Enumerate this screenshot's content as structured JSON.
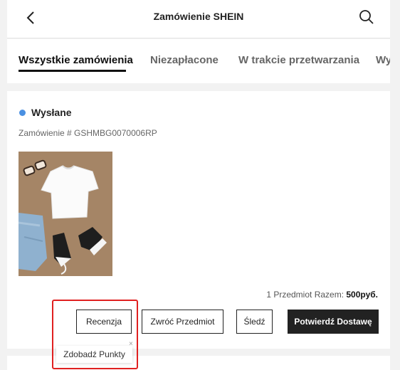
{
  "header": {
    "title": "Zamówienie SHEIN",
    "back_icon": "chevron-left-icon",
    "search_icon": "search-icon"
  },
  "tabs": [
    {
      "label": "Wszystkie zamówienia",
      "active": true
    },
    {
      "label": "Niezapłacone",
      "active": false
    },
    {
      "label": "W trakcie przetwarzania",
      "active": false
    },
    {
      "label": "Wy",
      "active": false
    }
  ],
  "order": {
    "status": "Wysłane",
    "status_color": "#4a90e2",
    "order_number": "Zamówienie # GSHMBG0070006RP",
    "total_label": "1 Przedmiot Razem: ",
    "total_value": "500руб."
  },
  "actions": {
    "review": "Recenzja",
    "return": "Zwróć Przedmiot",
    "track": "Śledź",
    "confirm": "Potwierdź Dostawę"
  },
  "tooltip": {
    "text": "Zdobadź Punkty",
    "close": "×"
  },
  "colors": {
    "highlight": "#e02020",
    "primary_button": "#222222"
  }
}
